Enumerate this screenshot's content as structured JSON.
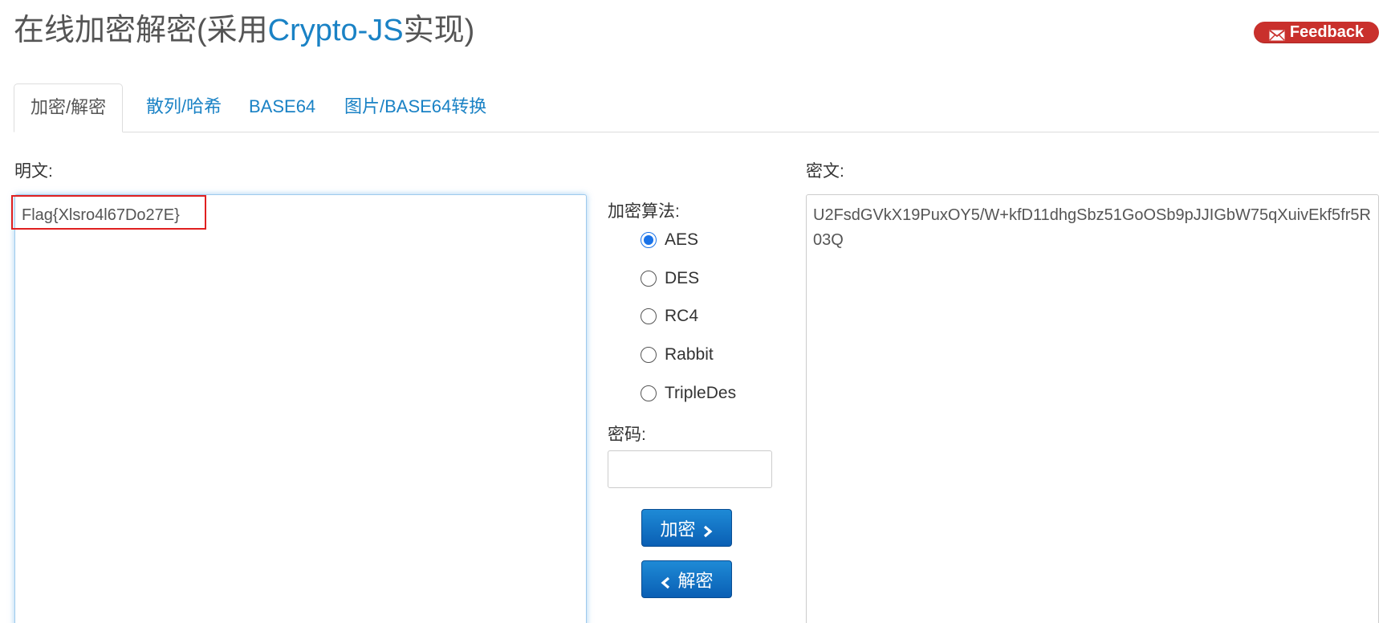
{
  "header": {
    "title_prefix": "在线加密解密(采用",
    "title_accent": "Crypto-JS",
    "title_suffix": "实现)",
    "feedback_label": "Feedback"
  },
  "tabs": [
    {
      "label": "加密/解密",
      "active": true
    },
    {
      "label": "散列/哈希",
      "active": false
    },
    {
      "label": "BASE64",
      "active": false
    },
    {
      "label": "图片/BASE64转换",
      "active": false
    }
  ],
  "plaintext": {
    "label": "明文:",
    "value": "Flag{Xlsro4l67Do27E}"
  },
  "ciphertext": {
    "label": "密文:",
    "value": "U2FsdGVkX19PuxOY5/W+kfD11dhgSbz51GoOSb9pJJIGbW75qXuivEkf5fr5R03Q"
  },
  "algorithm": {
    "label": "加密算法:",
    "options": [
      "AES",
      "DES",
      "RC4",
      "Rabbit",
      "TripleDes"
    ],
    "selected": "AES"
  },
  "password": {
    "label": "密码:",
    "value": ""
  },
  "actions": {
    "encrypt_label": "加密",
    "decrypt_label": "解密"
  },
  "colors": {
    "accent": "#1a82c5",
    "feedback_bg": "#c9302c",
    "button_bg": "#0a5fb4",
    "highlight": "#e02020"
  }
}
